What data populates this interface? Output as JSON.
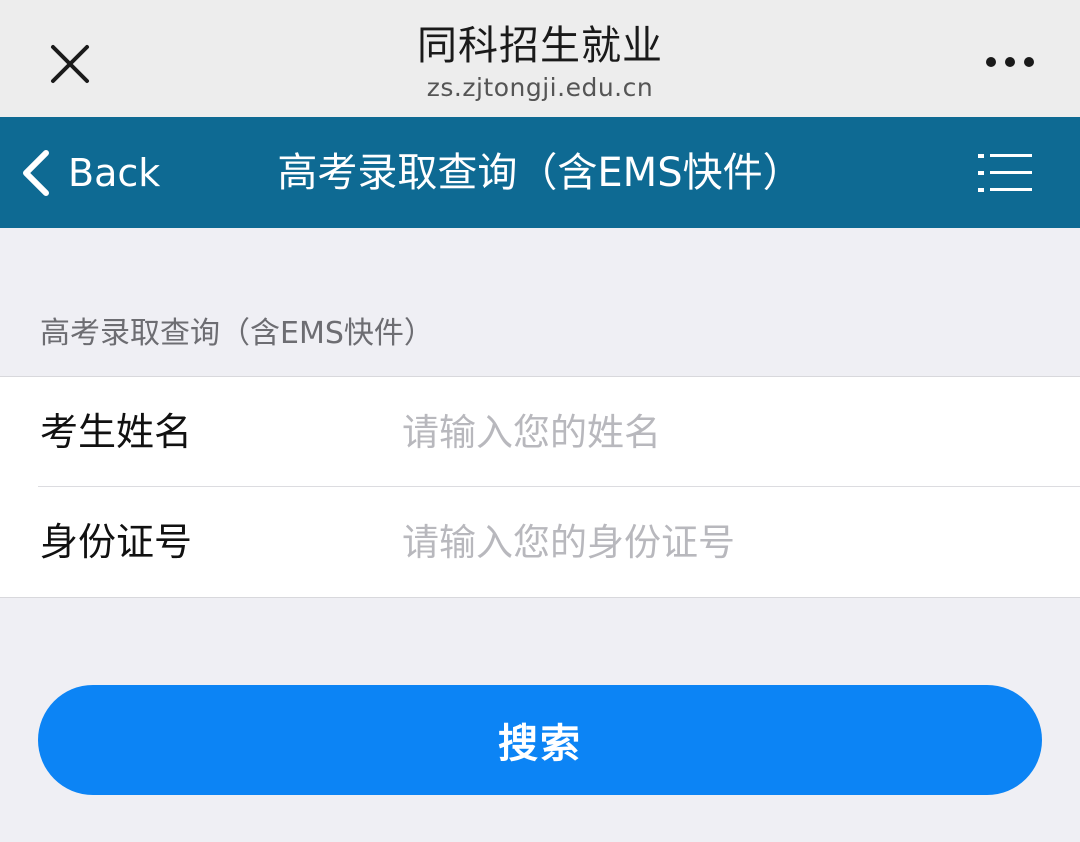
{
  "browser_header": {
    "title": "同科招生就业",
    "url": "zs.zjtongji.edu.cn",
    "close_icon": "close-icon",
    "more_icon": "more-horizontal-icon"
  },
  "navbar": {
    "back_label": "Back",
    "title": "高考录取查询（含EMS快件）",
    "menu_icon": "list-menu-icon",
    "background_color": "#0e6a93"
  },
  "form": {
    "section_label": "高考录取查询（含EMS快件）",
    "fields": [
      {
        "label": "考生姓名",
        "value": "",
        "placeholder": "请输入您的姓名"
      },
      {
        "label": "身份证号",
        "value": "",
        "placeholder": "请输入您的身份证号"
      }
    ]
  },
  "actions": {
    "search_label": "搜索",
    "search_color": "#0c84f5"
  }
}
